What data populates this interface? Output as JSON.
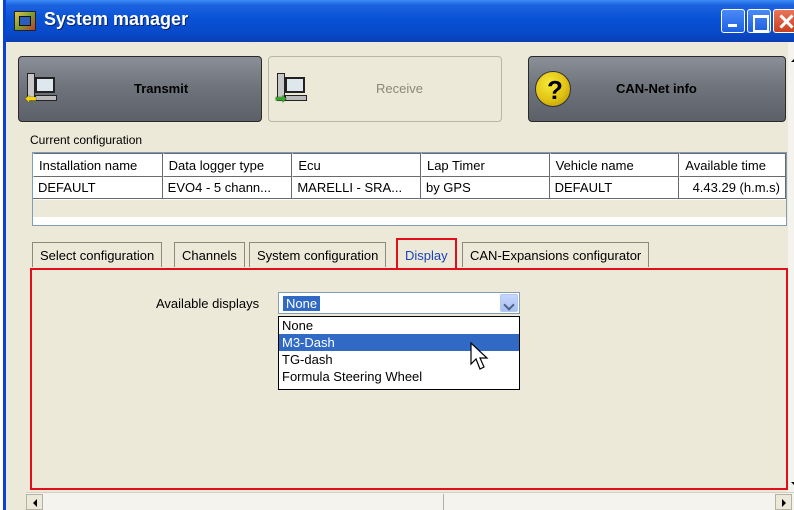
{
  "window": {
    "title": "System manager",
    "icon": "app-icon"
  },
  "toolbar": {
    "transmit_label": "Transmit",
    "receive_label": "Receive",
    "cannet_label": "CAN-Net info"
  },
  "config": {
    "section_label": "Current configuration",
    "columns": [
      "Installation name",
      "Data logger type",
      "Ecu",
      "Lap Timer",
      "Vehicle name",
      "Available time"
    ],
    "row": [
      "DEFAULT",
      "EVO4 - 5 chann...",
      "MARELLI - SRA...",
      "by GPS",
      "DEFAULT",
      "4.43.29 (h.m.s)"
    ]
  },
  "tabs": [
    {
      "label": "Select configuration"
    },
    {
      "label": "Channels"
    },
    {
      "label": "System configuration"
    },
    {
      "label": "Display",
      "active": true
    },
    {
      "label": "CAN-Expansions configurator"
    }
  ],
  "display": {
    "label": "Available displays",
    "selected": "None",
    "options": [
      "None",
      "M3-Dash",
      "TG-dash",
      "Formula Steering Wheel"
    ],
    "highlighted": "M3-Dash"
  },
  "colors": {
    "accent": "#e10f1a",
    "selection": "#316ac5",
    "titlebar": "#0852d6"
  }
}
